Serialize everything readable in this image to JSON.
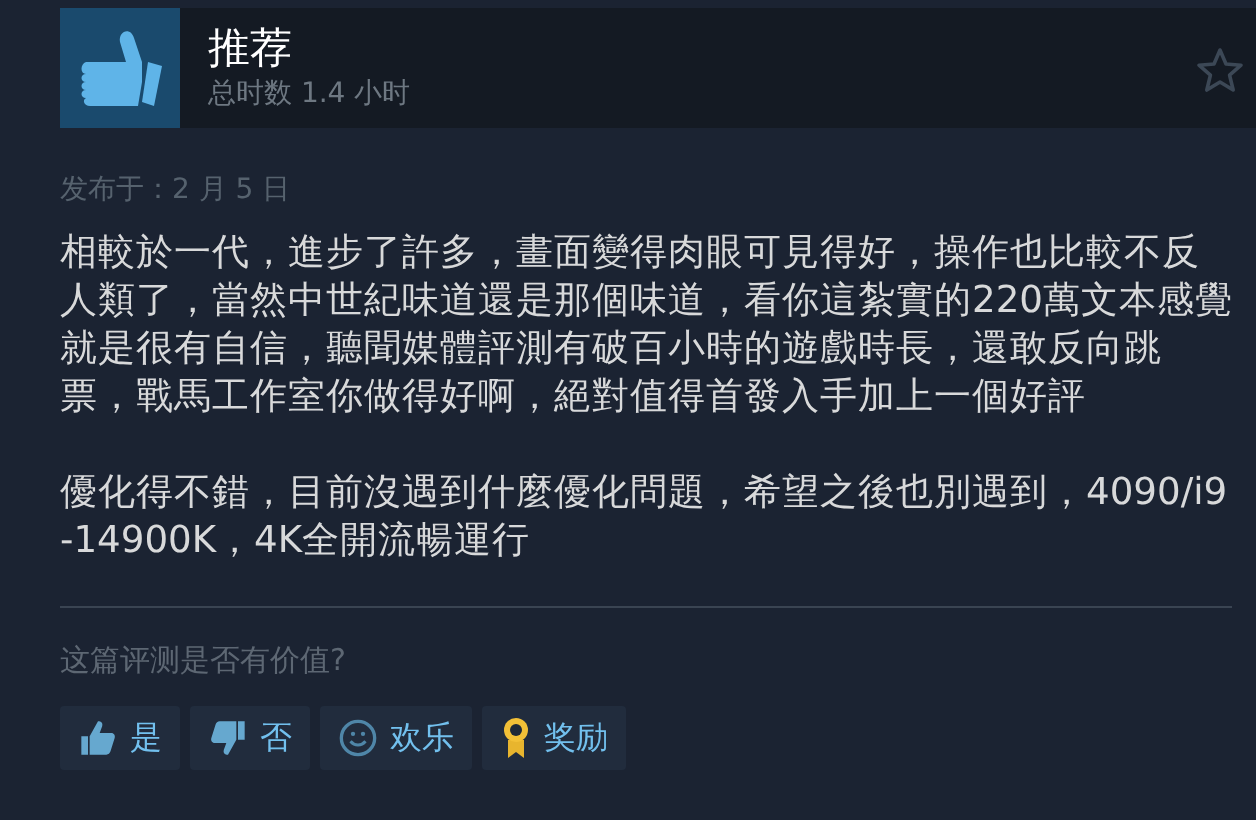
{
  "review": {
    "verdict": "推荐",
    "hours": "总时数 1.4 小时",
    "posted": "发布于：2 月 5 日",
    "paragraphs": [
      "相較於一代，進步了許多，畫面變得肉眼可見得好，操作也比較不反人類了，當然中世紀味道還是那個味道，看你這紮實的220萬文本感覺就是很有自信，聽聞媒體評測有破百小時的遊戲時長，還敢反向跳票，戰馬工作室你做得好啊，絕對值得首發入手加上一個好評",
      "優化得不錯，目前沒遇到什麼優化問題，希望之後也別遇到，4090/i9-14900K，4K全開流暢運行"
    ]
  },
  "helpful": {
    "question": "这篇评测是否有价值?",
    "buttons": [
      {
        "kind": "yes",
        "label": "是"
      },
      {
        "kind": "no",
        "label": "否"
      },
      {
        "kind": "funny",
        "label": "欢乐"
      },
      {
        "kind": "award",
        "label": "奖励"
      }
    ]
  }
}
